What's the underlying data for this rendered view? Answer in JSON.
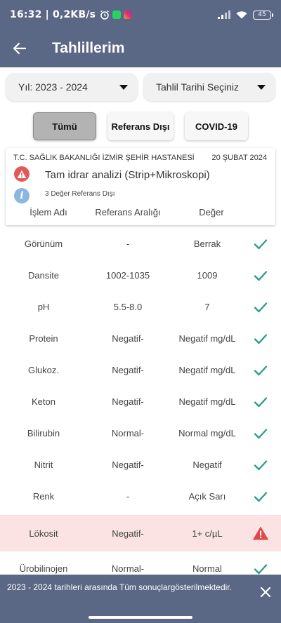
{
  "status_bar": {
    "time_speed": "16:32 | 0,2KB/s",
    "battery": "45",
    "alarm_icon": "alarm-clock-icon",
    "whatsapp_icon": "whatsapp-icon",
    "instagram_icon": "instagram-icon",
    "signal_icon": "signal-bars-icon",
    "wifi_icon": "wifi-icon"
  },
  "header": {
    "title": "Tahlillerim",
    "back_icon": "arrow-left-icon"
  },
  "filters": {
    "year": "Yıl: 2023 - 2024",
    "date_picker": "Tahlil Tarihi Seçiniz"
  },
  "tabs": [
    {
      "label": "Tümü",
      "active": true
    },
    {
      "label": "Referans Dışı",
      "active": false
    },
    {
      "label": "COVID-19",
      "active": false
    }
  ],
  "card": {
    "hospital": "T.C. SAĞLIK BAKANLIĞI İZMİR ŞEHİR HASTANESİ",
    "date": "20 ŞUBAT 2024",
    "test_name": "Tam idrar analizi (Strip+Mikroskopi)",
    "out_of_range_text": "3 Değer Referans Dışı",
    "columns": [
      "İşlem Adı",
      "Referans Aralığı",
      "Değer"
    ]
  },
  "results": [
    {
      "name": "Görünüm",
      "range": "-",
      "value": "Berrak",
      "status": "ok"
    },
    {
      "name": "Dansite",
      "range": "1002-1035",
      "value": "1009",
      "status": "ok"
    },
    {
      "name": "pH",
      "range": "5.5-8.0",
      "value": "7",
      "status": "ok"
    },
    {
      "name": "Protein",
      "range": "Negatif-",
      "value": "Negatif mg/dL",
      "status": "ok"
    },
    {
      "name": "Glukoz.",
      "range": "Negatif-",
      "value": "Negatif mg/dL",
      "status": "ok"
    },
    {
      "name": "Keton",
      "range": "Negatif-",
      "value": "Negatif mg/dL",
      "status": "ok"
    },
    {
      "name": "Bilirubin",
      "range": "Normal-",
      "value": "Normal mg/dL",
      "status": "ok"
    },
    {
      "name": "Nitrit",
      "range": "Negatif-",
      "value": "Negatif",
      "status": "ok"
    },
    {
      "name": "Renk",
      "range": "-",
      "value": "Açık Sarı",
      "status": "ok"
    },
    {
      "name": "Lökosit",
      "range": "Negatif-",
      "value": "1+ c/µL",
      "status": "warning"
    },
    {
      "name": "Ürobilinojen",
      "range": "Normal-",
      "value": "Normal",
      "status": "ok"
    }
  ],
  "toast": {
    "message": "2023 - 2024 tarihleri arasında Tüm sonuçlargösterilmektedir."
  },
  "colors": {
    "primary": "#5a6785",
    "ok_check": "#2e9e8a",
    "warning": "#e04848",
    "warning_row_bg": "#fbe3e3",
    "info": "#8ab6e0"
  }
}
